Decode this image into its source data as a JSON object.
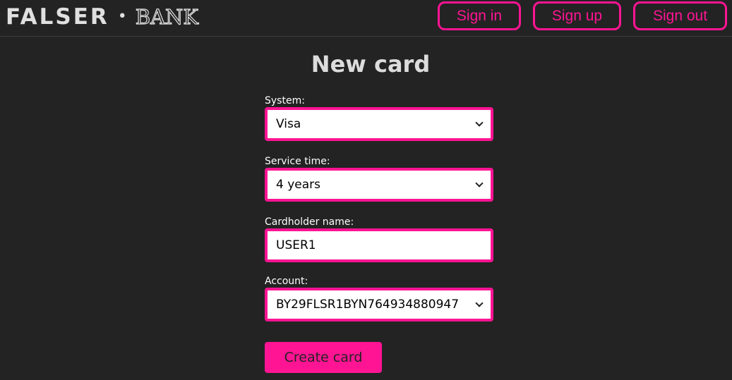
{
  "header": {
    "logo_left": "FALSER",
    "logo_separator": "•",
    "logo_right": "BANK",
    "nav": {
      "sign_in": "Sign in",
      "sign_up": "Sign up",
      "sign_out": "Sign out"
    }
  },
  "form": {
    "title": "New card",
    "system": {
      "label": "System:",
      "value": "Visa"
    },
    "service_time": {
      "label": "Service time:",
      "value": "4 years"
    },
    "cardholder_name": {
      "label": "Cardholder name:",
      "value": "USER1"
    },
    "account": {
      "label": "Account:",
      "value": "BY29FLSR1BYN764934880947"
    },
    "submit_label": "Create card"
  },
  "colors": {
    "background": "#232323",
    "accent": "#ff1493",
    "title": "#dcdcdc"
  }
}
